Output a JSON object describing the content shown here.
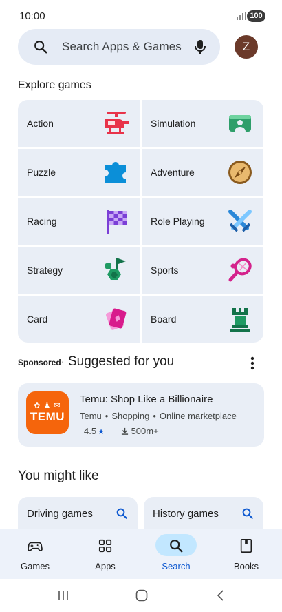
{
  "status": {
    "time": "10:00",
    "battery": "100"
  },
  "search": {
    "placeholder": "Search Apps & Games",
    "avatar_initial": "Z"
  },
  "explore": {
    "title": "Explore games",
    "categories": [
      {
        "label": "Action",
        "icon": "helicopter-icon"
      },
      {
        "label": "Simulation",
        "icon": "simulation-icon"
      },
      {
        "label": "Puzzle",
        "icon": "puzzle-piece-icon"
      },
      {
        "label": "Adventure",
        "icon": "compass-icon"
      },
      {
        "label": "Racing",
        "icon": "checkered-flag-icon"
      },
      {
        "label": "Role Playing",
        "icon": "crossed-swords-icon"
      },
      {
        "label": "Strategy",
        "icon": "strategy-flag-icon"
      },
      {
        "label": "Sports",
        "icon": "tennis-racket-icon"
      },
      {
        "label": "Card",
        "icon": "cards-icon"
      },
      {
        "label": "Board",
        "icon": "chess-rook-icon"
      }
    ]
  },
  "suggested": {
    "sponsored": "Sponsored",
    "separator": "·",
    "title": "Suggested for you",
    "app": {
      "name": "Temu: Shop Like a Billionaire",
      "developer": "Temu",
      "category": "Shopping",
      "subcategory": "Online marketplace",
      "rating": "4.5",
      "downloads": "500m+",
      "icon_text": "TEMU",
      "brand_color": "#f5650c"
    }
  },
  "you_might_like": {
    "title": "You might like",
    "items": [
      {
        "label": "Driving games"
      },
      {
        "label": "History games"
      }
    ]
  },
  "bottom_nav": {
    "items": [
      {
        "label": "Games",
        "icon": "gamepad-icon",
        "active": false
      },
      {
        "label": "Apps",
        "icon": "apps-grid-icon",
        "active": false
      },
      {
        "label": "Search",
        "icon": "search-icon",
        "active": true
      },
      {
        "label": "Books",
        "icon": "book-icon",
        "active": false
      }
    ]
  },
  "colors": {
    "accent": "#0b57d0",
    "card_bg": "#e9eef6",
    "active_pill": "#c2e7ff"
  }
}
